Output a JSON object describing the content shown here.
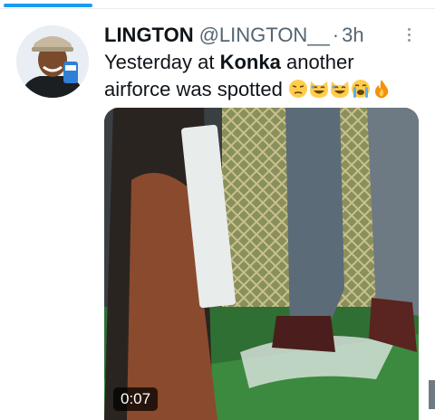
{
  "tweet": {
    "display_name": "LINGTON",
    "handle": "@LINGTON__",
    "separator": "·",
    "time": "3h",
    "text_before": "Yesterday at ",
    "text_bold": "Konka",
    "text_after": " another airforce was spotted",
    "emojis": [
      "unamused-face-icon",
      "grinning-cat-icon",
      "grinning-cat-icon",
      "loudly-crying-face-icon",
      "fire-icon"
    ]
  },
  "media": {
    "type": "video",
    "duration": "0:07"
  },
  "colors": {
    "accent": "#1d9bf0",
    "text_primary": "#0f1419",
    "text_secondary": "#536471"
  }
}
